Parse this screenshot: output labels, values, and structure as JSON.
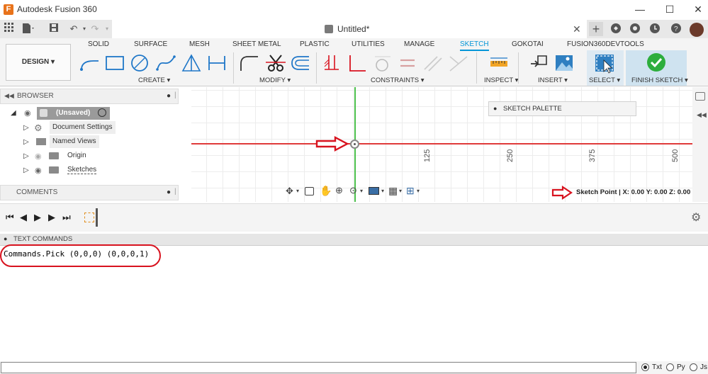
{
  "app": {
    "title": "Autodesk Fusion 360",
    "logo_letter": "F"
  },
  "window_controls": {
    "minimize": "—",
    "maximize": "☐",
    "close": "✕"
  },
  "document": {
    "title": "Untitled*",
    "close": "✕"
  },
  "workspace": {
    "label": "DESIGN ▾"
  },
  "tabs": [
    "SOLID",
    "SURFACE",
    "MESH",
    "SHEET METAL",
    "PLASTIC",
    "UTILITIES",
    "MANAGE",
    "SKETCH",
    "GOKOTAI",
    "FUSION360DEVTOOLS"
  ],
  "active_tab": "SKETCH",
  "groups": {
    "create": "CREATE ▾",
    "modify": "MODIFY ▾",
    "constraints": "CONSTRAINTS ▾",
    "inspect": "INSPECT ▾",
    "insert": "INSERT ▾",
    "select": "SELECT ▾",
    "finish": "FINISH SKETCH ▾"
  },
  "browser": {
    "title": "BROWSER",
    "root": "(Unsaved)",
    "items": [
      "Document Settings",
      "Named Views",
      "Origin",
      "Sketches"
    ],
    "comments": "COMMENTS"
  },
  "palette": {
    "label": "SKETCH PALETTE"
  },
  "ruler": [
    "125",
    "250",
    "375",
    "500"
  ],
  "status": {
    "text": "Sketch Point | X: 0.00 Y: 0.00 Z: 0.00 mm"
  },
  "text_commands": {
    "title": "TEXT COMMANDS",
    "output": "Commands.Pick (0,0,0) (0,0,0,1)"
  },
  "input_modes": [
    "Txt",
    "Py",
    "Js"
  ],
  "selected_mode": "Txt",
  "colors": {
    "accent": "#0696d7",
    "annotation": "#d8131f",
    "axis_red": "#e03a3a",
    "axis_green": "#4cc04c",
    "finish_green": "#2dae3d"
  }
}
